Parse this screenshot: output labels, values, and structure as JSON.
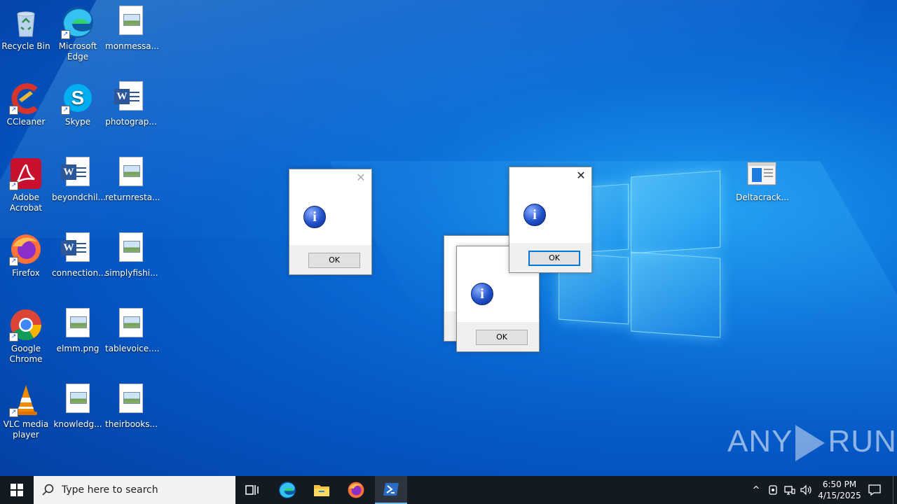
{
  "desktop": {
    "icons": [
      {
        "name": "recycle-bin",
        "label": "Recycle Bin"
      },
      {
        "name": "microsoft-edge",
        "label": "Microsoft Edge"
      },
      {
        "name": "monmessa",
        "label": "monmessa..."
      },
      {
        "name": "ccleaner",
        "label": "CCleaner"
      },
      {
        "name": "skype",
        "label": "Skype"
      },
      {
        "name": "photograp",
        "label": "photograp..."
      },
      {
        "name": "adobe-acrobat",
        "label": "Adobe Acrobat"
      },
      {
        "name": "beyondchil",
        "label": "beyondchil..."
      },
      {
        "name": "returnresta",
        "label": "returnresta..."
      },
      {
        "name": "firefox",
        "label": "Firefox"
      },
      {
        "name": "connection",
        "label": "connection..."
      },
      {
        "name": "simplyfishi",
        "label": "simplyfishi..."
      },
      {
        "name": "google-chrome",
        "label": "Google Chrome"
      },
      {
        "name": "elmm",
        "label": "elmm.png"
      },
      {
        "name": "tablevoice",
        "label": "tablevoice...."
      },
      {
        "name": "vlc",
        "label": "VLC media player"
      },
      {
        "name": "knowledg",
        "label": "knowledg..."
      },
      {
        "name": "theirbooks",
        "label": "theirbooks..."
      },
      {
        "name": "deltacrack",
        "label": "Deltacrack..."
      }
    ]
  },
  "dialogs": {
    "ok_label": "OK",
    "info_glyph": "i"
  },
  "watermark": {
    "left": "ANY",
    "right": "RUN"
  },
  "taskbar": {
    "search_placeholder": "Type here to search",
    "time": "6:50 PM",
    "date": "4/15/2025"
  },
  "colors": {
    "taskbar": "#141a22",
    "accent": "#0078d7",
    "wallpaper": "#0a6fd8"
  }
}
